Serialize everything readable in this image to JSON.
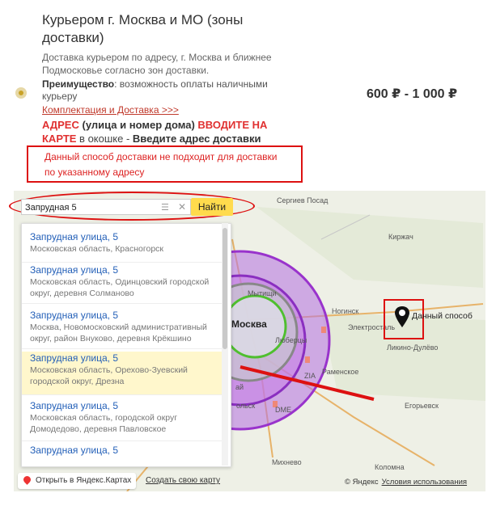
{
  "delivery": {
    "title": "Курьером г. Москва и МО (зоны доставки)",
    "description": "Доставка курьером по адресу, г. Москва и ближнее Подмосковье согласно зон доставки.",
    "advantage_label": "Преимущество",
    "advantage_text": ": возможность оплаты наличными курьеру",
    "link": "Комплектация и Доставка >>>",
    "addr_part1": "АДРЕС",
    "addr_part2": " (улица и номер дома) ",
    "addr_part3": "ВВОДИТЕ НА КАРТЕ",
    "addr_part4": " в окошке - ",
    "addr_part5": "Введите адрес доставки",
    "price": "600 ₽ - 1 000 ₽",
    "warning": "Данный способ доставки не подходит для доставки по указанному адресу"
  },
  "map": {
    "search_value": "Запрудная 5",
    "search_button": "Найти",
    "balloon_text": "Данный способ",
    "open_in_maps": "Открыть в Яндекс.Картах",
    "create_map": "Создать свою карту",
    "copyright": "© Яндекс",
    "terms": "Условия использования",
    "labels": {
      "moscow": "Москва",
      "sergiev": "Сергиев Посад",
      "kirzhach": "Киржач",
      "noginsk": "Ногинск",
      "elektrostal": "Электросталь",
      "likino": "Ликино-Дулёво",
      "ramenskoe": "Раменское",
      "egorevsk": "Егорьевск",
      "kolomna": "Коломна",
      "mikhnevo": "Михнево",
      "lyubertsy": "Люберцы",
      "mytishchi": "Мытищи",
      "zia": "ZIA",
      "dme": "DME",
      "dolsk": "ольск",
      "ai": "ай"
    },
    "suggestions": [
      {
        "title": "Запрудная улица, 5",
        "subtitle": "Московская область, Красногорск"
      },
      {
        "title": "Запрудная улица, 5",
        "subtitle": "Московская область, Одинцовский городской округ, деревня Солманово"
      },
      {
        "title": "Запрудная улица, 5",
        "subtitle": "Москва, Новомосковский административный округ, район Внуково, деревня Крёкшино"
      },
      {
        "title": "Запрудная улица, 5",
        "subtitle": "Московская область, Орехово-Зуевский городской округ, Дрезна"
      },
      {
        "title": "Запрудная улица, 5",
        "subtitle": "Московская область, городской округ Домодедово, деревня Павловское"
      },
      {
        "title": "Запрудная улица, 5",
        "subtitle": ""
      }
    ]
  }
}
